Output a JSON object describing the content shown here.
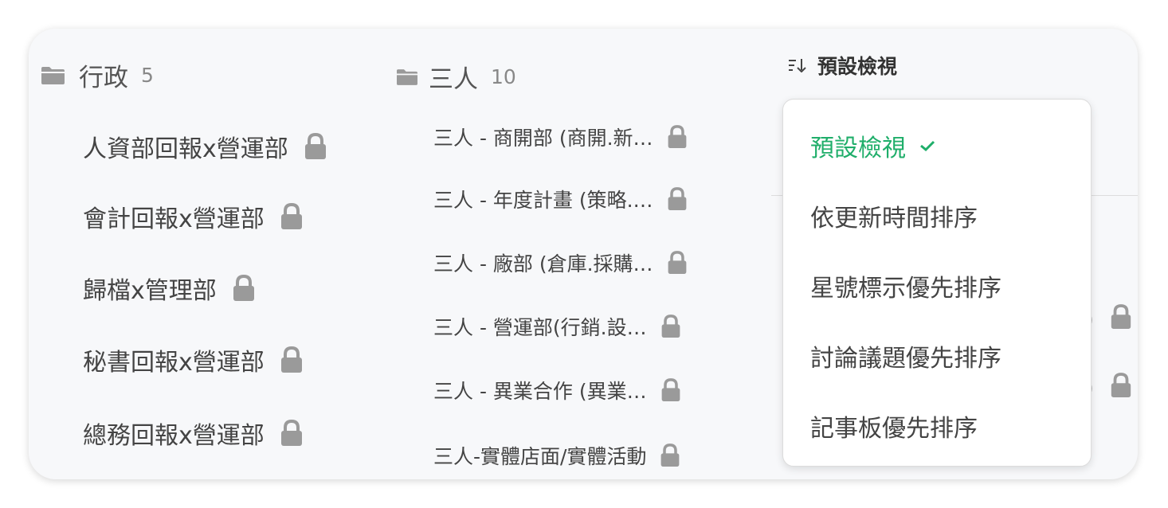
{
  "colors": {
    "accent": "#1fae6a",
    "icon": "#9a9a9a",
    "text": "#444444",
    "muted": "#888888"
  },
  "icons": {
    "folder": "folder-icon",
    "lock": "lock-icon",
    "sort": "sort-icon",
    "check": "check-icon"
  },
  "folders": [
    {
      "name": "行政",
      "count": "5",
      "items": [
        {
          "label": "人資部回報x營運部"
        },
        {
          "label": "會計回報x營運部"
        },
        {
          "label": "歸檔x管理部"
        },
        {
          "label": "秘書回報x營運部"
        },
        {
          "label": "總務回報x營運部"
        }
      ]
    },
    {
      "name": "三人",
      "count": "10",
      "items": [
        {
          "label": "三人 - 商開部 (商開.新…"
        },
        {
          "label": "三人 - 年度計畫 (策略.…"
        },
        {
          "label": "三人 - 廠部 (倉庫.採購…"
        },
        {
          "label": "三人 - 營運部(行銷.設…"
        },
        {
          "label": "三人 - 異業合作 (異業…"
        },
        {
          "label": "三人-實體店面/實體活動"
        }
      ]
    }
  ],
  "sort": {
    "button_label": "預設檢視",
    "options": [
      {
        "label": "預設檢視",
        "selected": true
      },
      {
        "label": "依更新時間排序",
        "selected": false
      },
      {
        "label": "星號標示優先排序",
        "selected": false
      },
      {
        "label": "討論議題優先排序",
        "selected": false
      },
      {
        "label": "記事板優先排序",
        "selected": false
      }
    ]
  }
}
